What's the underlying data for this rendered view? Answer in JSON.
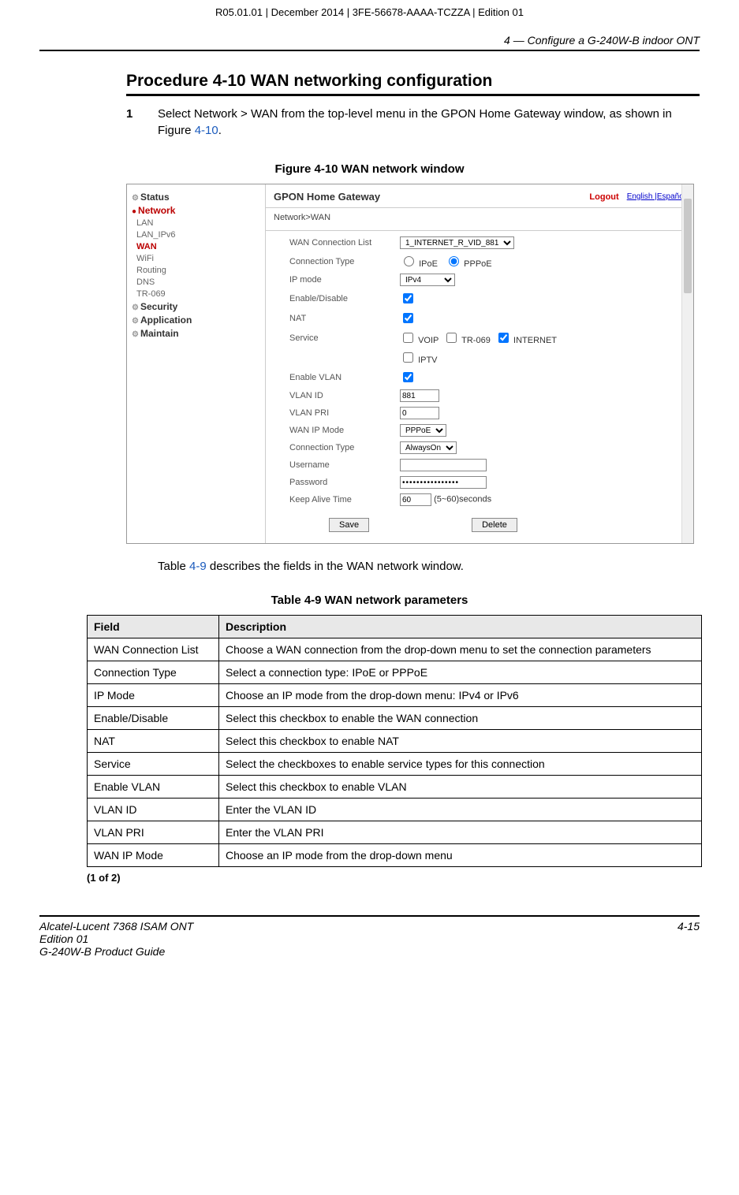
{
  "meta": {
    "top_line": "R05.01.01 | December 2014 | 3FE-56678-AAAA-TCZZA | Edition 01",
    "header_right": "4 —  Configure a G-240W-B indoor ONT"
  },
  "procedure": {
    "title": "Procedure 4-10  WAN networking configuration",
    "step_num": "1",
    "step_text_a": "Select Network > WAN from the top-level menu in the GPON Home Gateway window, as shown in Figure ",
    "step_link": "4-10",
    "step_text_b": "."
  },
  "figure": {
    "caption": "Figure 4-10  WAN network window",
    "header_title": "GPON Home Gateway",
    "logout": "Logout",
    "lang": "English |Español",
    "breadcrumb": "Network>WAN",
    "sidebar": {
      "status": "Status",
      "network": "Network",
      "lan": "LAN",
      "lan_ipv6": "LAN_IPv6",
      "wan": "WAN",
      "wifi": "WiFi",
      "routing": "Routing",
      "dns": "DNS",
      "tr069": "TR-069",
      "security": "Security",
      "application": "Application",
      "maintain": "Maintain"
    },
    "form": {
      "wan_conn_list_lbl": "WAN Connection List",
      "wan_conn_list_val": "1_INTERNET_R_VID_881",
      "conn_type_lbl": "Connection Type",
      "ipoe": "IPoE",
      "pppoe": "PPPoE",
      "ip_mode_lbl": "IP mode",
      "ip_mode_val": "IPv4",
      "enable_lbl": "Enable/Disable",
      "nat_lbl": "NAT",
      "service_lbl": "Service",
      "svc_voip": "VOIP",
      "svc_tr069": "TR-069",
      "svc_internet": "INTERNET",
      "svc_iptv": "IPTV",
      "enable_vlan_lbl": "Enable VLAN",
      "vlan_id_lbl": "VLAN ID",
      "vlan_id_val": "881",
      "vlan_pri_lbl": "VLAN PRI",
      "vlan_pri_val": "0",
      "wan_ip_mode_lbl": "WAN IP Mode",
      "wan_ip_mode_val": "PPPoE",
      "conn_type2_lbl": "Connection Type",
      "conn_type2_val": "AlwaysOn",
      "username_lbl": "Username",
      "password_lbl": "Password",
      "password_val": "••••••••••••••••",
      "keepalive_lbl": "Keep Alive Time",
      "keepalive_val": "60",
      "keepalive_suffix": "(5~60)seconds",
      "save_btn": "Save",
      "delete_btn": "Delete"
    }
  },
  "body": {
    "intro_a": "Table ",
    "intro_link": "4-9",
    "intro_b": " describes the fields in the WAN network window."
  },
  "table": {
    "caption": "Table 4-9 WAN network parameters",
    "h_field": "Field",
    "h_desc": "Description",
    "rows": [
      {
        "f": "WAN Connection List",
        "d": "Choose a WAN connection from the drop-down menu to set the connection parameters"
      },
      {
        "f": "Connection Type",
        "d": "Select a connection type: IPoE or PPPoE"
      },
      {
        "f": "IP Mode",
        "d": "Choose an IP mode from the drop-down menu: IPv4 or IPv6"
      },
      {
        "f": "Enable/Disable",
        "d": "Select this checkbox to enable the WAN connection"
      },
      {
        "f": "NAT",
        "d": "Select this checkbox to enable NAT"
      },
      {
        "f": "Service",
        "d": "Select the checkboxes to enable service types for this connection"
      },
      {
        "f": "Enable VLAN",
        "d": "Select this checkbox to enable VLAN"
      },
      {
        "f": "VLAN ID",
        "d": "Enter the VLAN ID"
      },
      {
        "f": "VLAN PRI",
        "d": "Enter the VLAN PRI"
      },
      {
        "f": "WAN IP Mode",
        "d": "Choose an IP mode from the drop-down menu"
      }
    ],
    "foot": "(1 of 2)"
  },
  "footer": {
    "l1": "Alcatel-Lucent 7368 ISAM ONT",
    "l2": "Edition 01",
    "l3": "G-240W-B Product Guide",
    "page": "4-15"
  }
}
